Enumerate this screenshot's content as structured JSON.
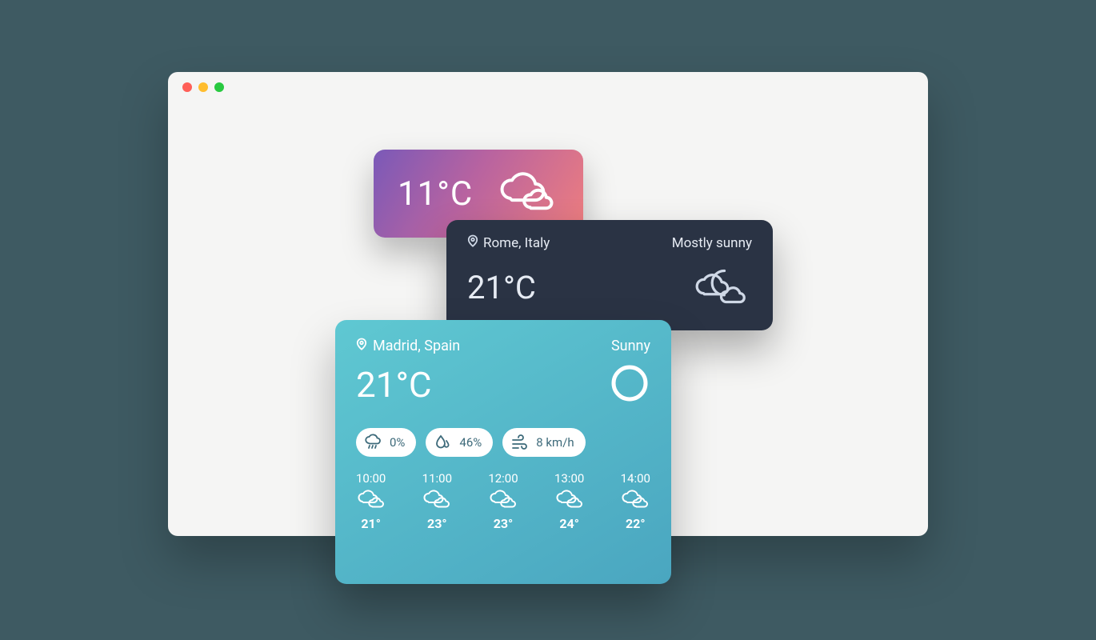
{
  "cardSmall": {
    "temp": "11°C"
  },
  "cardMedium": {
    "location": "Rome, Italy",
    "condition": "Mostly sunny",
    "temp": "21°C"
  },
  "cardLarge": {
    "location": "Madrid, Spain",
    "condition": "Sunny",
    "temp": "21°C",
    "metrics": {
      "precipitation": "0%",
      "humidity": "46%",
      "wind": "8 km/h"
    },
    "hours": [
      {
        "time": "10:00",
        "temp": "21°"
      },
      {
        "time": "11:00",
        "temp": "23°"
      },
      {
        "time": "12:00",
        "temp": "23°"
      },
      {
        "time": "13:00",
        "temp": "24°"
      },
      {
        "time": "14:00",
        "temp": "22°"
      }
    ]
  }
}
